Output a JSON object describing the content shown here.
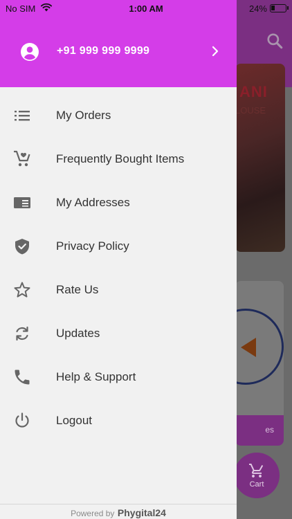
{
  "status_bar": {
    "carrier": "No SIM",
    "time": "1:00 AM",
    "battery": "24%"
  },
  "drawer": {
    "phone": "+91 999 999 9999",
    "menu": [
      {
        "label": "My Orders",
        "icon": "list-icon"
      },
      {
        "label": "Frequently Bought Items",
        "icon": "cart-heart-icon"
      },
      {
        "label": "My Addresses",
        "icon": "address-card-icon"
      },
      {
        "label": "Privacy Policy",
        "icon": "shield-check-icon"
      },
      {
        "label": "Rate Us",
        "icon": "star-icon"
      },
      {
        "label": "Updates",
        "icon": "sync-icon"
      },
      {
        "label": "Help & Support",
        "icon": "phone-icon"
      },
      {
        "label": "Logout",
        "icon": "power-icon"
      }
    ],
    "footer": {
      "prefix": "Powered by",
      "brand": "Phygital24"
    }
  },
  "background": {
    "banner_text_1": "ANI",
    "banner_text_2": "LOUSE",
    "card_strip_text": "es",
    "cart_label": "Cart"
  },
  "colors": {
    "drawer_header": "#d43de8",
    "drawer_bg": "#f1f1f1",
    "menu_text": "#333333",
    "icon": "#666666"
  }
}
